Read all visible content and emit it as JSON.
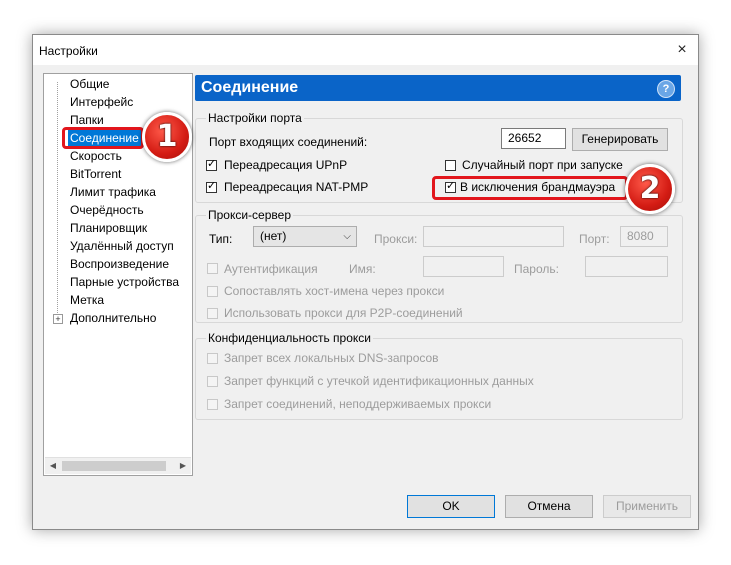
{
  "window": {
    "title": "Настройки",
    "close_glyph": "×"
  },
  "tree": {
    "items": [
      {
        "label": "Общие"
      },
      {
        "label": "Интерфейс"
      },
      {
        "label": "Папки"
      },
      {
        "label": "Соединение",
        "selected": true
      },
      {
        "label": "Скорость"
      },
      {
        "label": "BitTorrent"
      },
      {
        "label": "Лимит трафика"
      },
      {
        "label": "Очерёдность"
      },
      {
        "label": "Планировщик"
      },
      {
        "label": "Удалённый доступ"
      },
      {
        "label": "Воспроизведение"
      },
      {
        "label": "Парные устройства"
      },
      {
        "label": "Метка"
      },
      {
        "label": "Дополнительно",
        "expandable": true
      }
    ],
    "expander_glyph": "+"
  },
  "panel": {
    "title": "Соединение",
    "help_glyph": "?"
  },
  "port": {
    "group_title": "Настройки порта",
    "incoming_label": "Порт входящих соединений:",
    "incoming_value": "26652",
    "generate_label": "Генерировать",
    "upnp_label": "Переадресация UPnP",
    "upnp_checked": true,
    "natpmp_label": "Переадресация NAT-PMP",
    "natpmp_checked": true,
    "random_label": "Случайный порт при запуске",
    "random_checked": false,
    "firewall_label": "В исключения брандмауэра",
    "firewall_checked": true
  },
  "proxy": {
    "group_title": "Прокси-сервер",
    "type_label": "Тип:",
    "type_value": "(нет)",
    "proxy_label": "Прокси:",
    "proxy_value": "",
    "port_label": "Порт:",
    "port_value": "8080",
    "auth_label": "Аутентификация",
    "name_label": "Имя:",
    "password_label": "Пароль:",
    "resolve_label": "Сопоставлять хост-имена через прокси",
    "p2p_label": "Использовать прокси для P2P-соединений"
  },
  "privacy": {
    "group_title": "Конфиденциальность прокси",
    "dns_label": "Запрет всех локальных DNS-запросов",
    "leak_label": "Запрет функций с утечкой идентификационных данных",
    "unsupported_label": "Запрет соединений, неподдерживаемых прокси"
  },
  "buttons": {
    "ok": "OK",
    "cancel": "Отмена",
    "apply": "Применить"
  },
  "annotations": {
    "badge1": "1",
    "badge2": "2"
  },
  "colors": {
    "accent": "#0a64c8",
    "selection": "#0078d7",
    "annotation": "#e2161c"
  }
}
